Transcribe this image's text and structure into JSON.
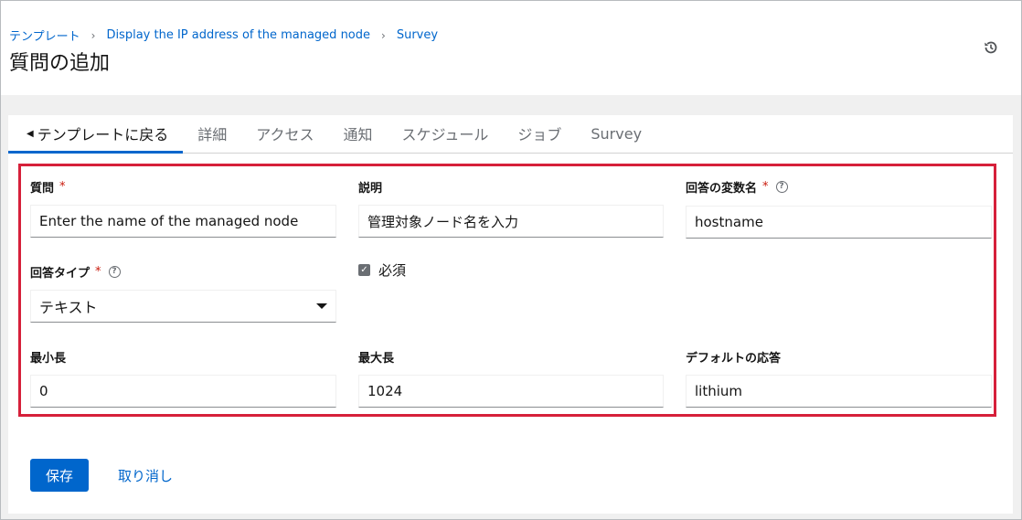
{
  "breadcrumb": {
    "items": [
      "テンプレート",
      "Display the IP address of the managed node",
      "Survey"
    ],
    "separator": "›"
  },
  "page_title": "質問の追加",
  "tabs": {
    "back_label": "テンプレートに戻る",
    "items": [
      "詳細",
      "アクセス",
      "通知",
      "スケジュール",
      "ジョブ",
      "Survey"
    ]
  },
  "form": {
    "question": {
      "label": "質問",
      "required": "*",
      "value": "Enter the name of the managed node"
    },
    "description": {
      "label": "説明",
      "value": "管理対象ノード名を入力"
    },
    "variable": {
      "label": "回答の変数名",
      "required": "*",
      "help": "?",
      "value": "hostname"
    },
    "answer_type": {
      "label": "回答タイプ",
      "required": "*",
      "help": "?",
      "value": "テキスト"
    },
    "required_check": {
      "label": "必須",
      "checked": true,
      "mark": "✓"
    },
    "min_length": {
      "label": "最小長",
      "value": "0"
    },
    "max_length": {
      "label": "最大長",
      "value": "1024"
    },
    "default_answer": {
      "label": "デフォルトの応答",
      "value": "lithium"
    }
  },
  "actions": {
    "save": "保存",
    "cancel": "取り消し"
  },
  "colors": {
    "accent": "#0066cc",
    "highlight": "#d6203a",
    "required": "#c9190b"
  },
  "icons": {
    "history": "history-icon",
    "back": "caret-left-icon",
    "dropdown": "caret-down-icon"
  }
}
